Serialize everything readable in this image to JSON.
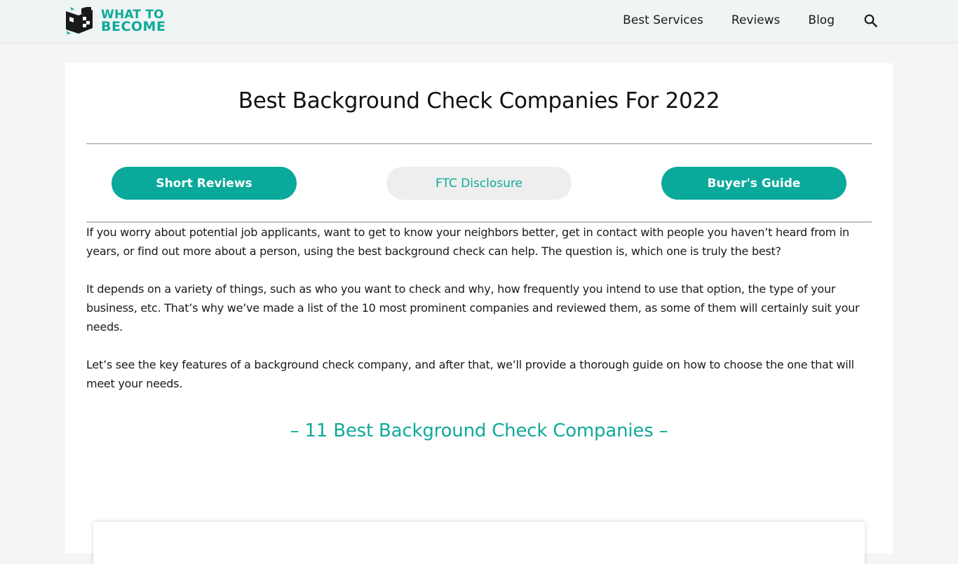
{
  "header": {
    "logo_line1": "WHAT TO",
    "logo_line2": "BECOME",
    "nav": [
      {
        "label": "Best Services"
      },
      {
        "label": "Reviews"
      },
      {
        "label": "Blog"
      }
    ],
    "search_icon": "search-icon"
  },
  "main": {
    "title": "Best Background Check Companies For 2022",
    "tabs": [
      {
        "label": "Short Reviews",
        "style": "primary"
      },
      {
        "label": "FTC Disclosure",
        "style": "secondary"
      },
      {
        "label": "Buyer's Guide",
        "style": "primary"
      }
    ],
    "paragraphs": [
      "If you worry about potential job applicants, want to get to know your neighbors better, get in contact with people you haven’t heard from in years, or find out more about a person, using the best background check can help. The question is, which one is truly the best?",
      "It depends on a variety of things, such as who you want to check and why, how frequently you intend to use that option, the type of your business, etc. That’s why we’ve made a list of the 10 most prominent companies and reviewed them, as some of them will certainly suit your needs.",
      "Let’s see the key features of a background check company, and after that, we’ll provide a thorough guide on how to choose the one that will meet your needs."
    ],
    "section_heading": "– 11 Best Background Check Companies –"
  },
  "colors": {
    "accent": "#0aa99b",
    "header_bg": "#eef5f4",
    "page_bg": "#f5f5f5",
    "secondary_button_bg": "#eeeeee",
    "divider": "#b9c3c6"
  }
}
